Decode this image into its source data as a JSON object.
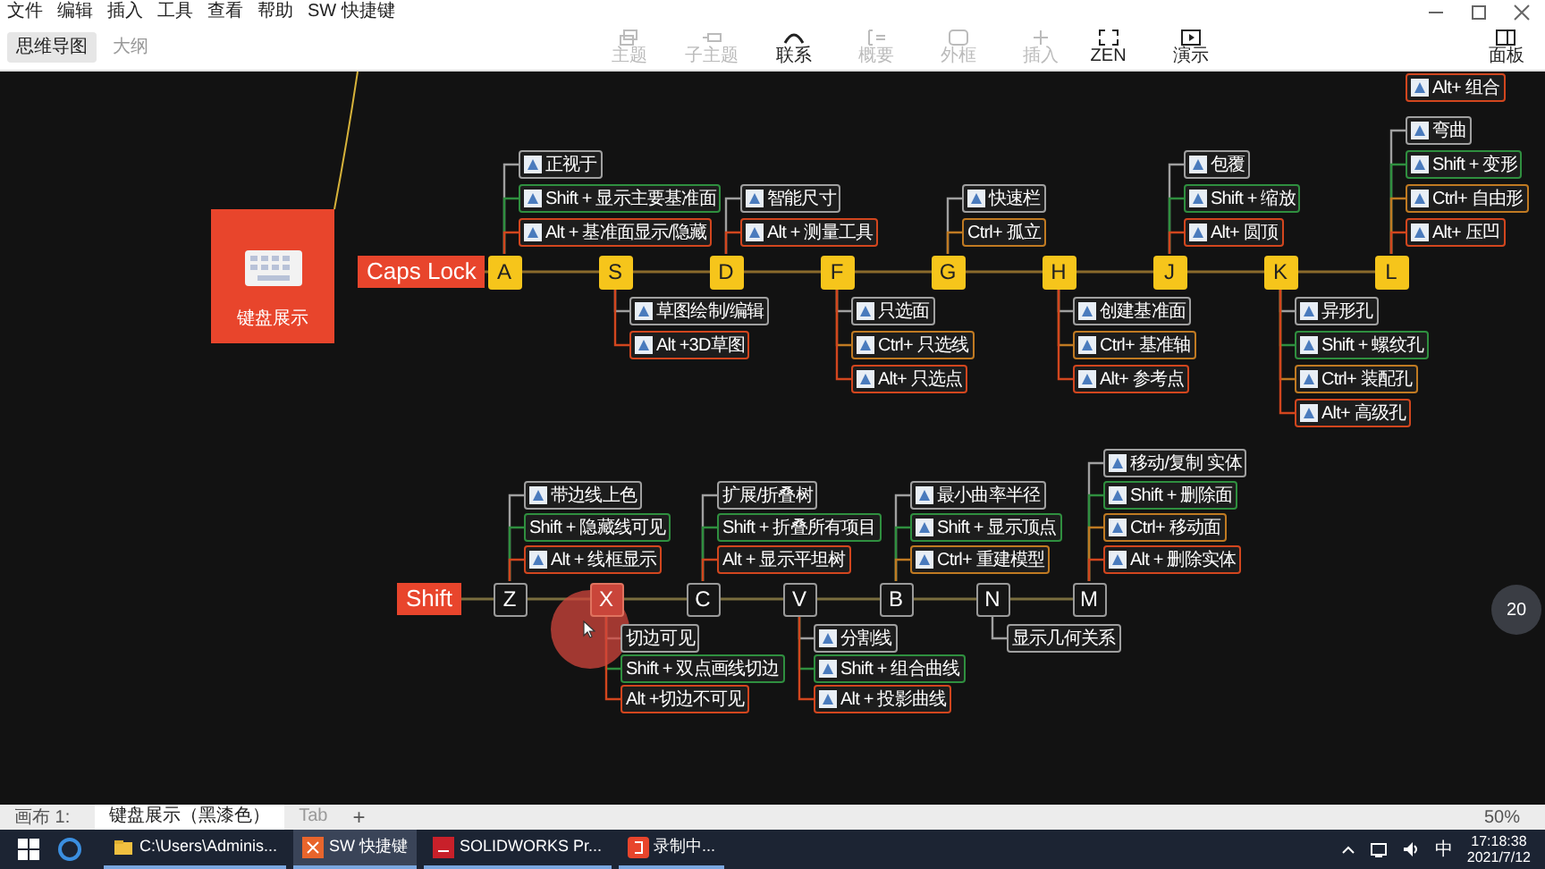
{
  "menu": [
    "文件",
    "编辑",
    "插入",
    "工具",
    "查看",
    "帮助",
    "SW 快捷键"
  ],
  "view_tabs": [
    {
      "label": "思维导图",
      "selected": true
    },
    {
      "label": "大纲",
      "selected": false
    }
  ],
  "toolbar": [
    {
      "label": "主题",
      "disabled": true
    },
    {
      "label": "子主题",
      "disabled": true
    },
    {
      "label": "联系",
      "disabled": false
    },
    {
      "label": "概要",
      "disabled": true
    },
    {
      "label": "外框",
      "disabled": true
    },
    {
      "label": "插入",
      "disabled": true
    }
  ],
  "right_tools": [
    {
      "label": "ZEN"
    },
    {
      "label": "演示"
    }
  ],
  "panel_button": "面板",
  "central_topic": "键盘展示",
  "top_partial_nodes": [
    {
      "text": "Alt+ 组合",
      "color": "#d2461e",
      "has_icon": true
    }
  ],
  "rows": [
    {
      "label": "Caps Lock",
      "keys": [
        {
          "key": "A",
          "kind": "yellow",
          "clicked": false,
          "above": [
            {
              "text": "正视于",
              "color": "#a0a0a0",
              "has_icon": true
            },
            {
              "text": "Shift + 显示主要基准面",
              "color": "#2f8f3f",
              "has_icon": true
            },
            {
              "text": "Alt + 基准面显示/隐藏",
              "color": "#d2461e",
              "has_icon": true
            }
          ]
        },
        {
          "key": "S",
          "kind": "yellow",
          "clicked": false,
          "below": [
            {
              "text": "草图绘制/编辑",
              "color": "#a0a0a0",
              "has_icon": true
            },
            {
              "text": "Alt +3D草图",
              "color": "#d2461e",
              "has_icon": true
            }
          ]
        },
        {
          "key": "D",
          "kind": "yellow",
          "clicked": false,
          "above": [
            {
              "text": "智能尺寸",
              "color": "#a0a0a0",
              "has_icon": true
            },
            {
              "text": "Alt + 测量工具",
              "color": "#d2461e",
              "has_icon": true
            }
          ]
        },
        {
          "key": "F",
          "kind": "yellow",
          "clicked": false,
          "below": [
            {
              "text": "只选面",
              "color": "#a0a0a0",
              "has_icon": true
            },
            {
              "text": "Ctrl+ 只选线",
              "color": "#c07a22",
              "has_icon": true
            },
            {
              "text": "Alt+ 只选点",
              "color": "#d2461e",
              "has_icon": true
            }
          ]
        },
        {
          "key": "G",
          "kind": "yellow",
          "clicked": false,
          "above": [
            {
              "text": "快速栏",
              "color": "#a0a0a0",
              "has_icon": true
            },
            {
              "text": "Ctrl+ 孤立",
              "color": "#c07a22",
              "has_icon": false
            }
          ]
        },
        {
          "key": "H",
          "kind": "yellow",
          "clicked": false,
          "below": [
            {
              "text": "创建基准面",
              "color": "#a0a0a0",
              "has_icon": true
            },
            {
              "text": "Ctrl+ 基准轴",
              "color": "#c07a22",
              "has_icon": true
            },
            {
              "text": "Alt+ 参考点",
              "color": "#d2461e",
              "has_icon": true
            }
          ]
        },
        {
          "key": "J",
          "kind": "yellow",
          "clicked": false,
          "above": [
            {
              "text": "包覆",
              "color": "#a0a0a0",
              "has_icon": true
            },
            {
              "text": "Shift + 缩放",
              "color": "#2f8f3f",
              "has_icon": true
            },
            {
              "text": "Alt+ 圆顶",
              "color": "#d2461e",
              "has_icon": true
            }
          ]
        },
        {
          "key": "K",
          "kind": "yellow",
          "clicked": false,
          "below": [
            {
              "text": "异形孔",
              "color": "#a0a0a0",
              "has_icon": true
            },
            {
              "text": "Shift + 螺纹孔",
              "color": "#2f8f3f",
              "has_icon": true
            },
            {
              "text": "Ctrl+ 装配孔",
              "color": "#c07a22",
              "has_icon": true
            },
            {
              "text": "Alt+ 高级孔",
              "color": "#d2461e",
              "has_icon": true
            }
          ]
        },
        {
          "key": "L",
          "kind": "yellow",
          "clicked": false,
          "above": [
            {
              "text": "弯曲",
              "color": "#a0a0a0",
              "has_icon": true
            },
            {
              "text": "Shift + 变形",
              "color": "#2f8f3f",
              "has_icon": true
            },
            {
              "text": "Ctrl+ 自由形",
              "color": "#c07a22",
              "has_icon": true
            },
            {
              "text": "Alt+ 压凹",
              "color": "#d2461e",
              "has_icon": true
            }
          ]
        }
      ]
    },
    {
      "label": "Shift",
      "keys": [
        {
          "key": "Z",
          "kind": "dark",
          "clicked": false,
          "above": [
            {
              "text": "带边线上色",
              "color": "#a0a0a0",
              "has_icon": true
            },
            {
              "text": "Shift + 隐藏线可见",
              "color": "#2f8f3f",
              "has_icon": false
            },
            {
              "text": "Alt + 线框显示",
              "color": "#d2461e",
              "has_icon": true
            }
          ]
        },
        {
          "key": "X",
          "kind": "dark",
          "clicked": true,
          "below": [
            {
              "text": "切边可见",
              "color": "#a0a0a0",
              "has_icon": false
            },
            {
              "text": "Shift + 双点画线切边",
              "color": "#2f8f3f",
              "has_icon": false
            },
            {
              "text": "Alt +切边不可见",
              "color": "#d2461e",
              "has_icon": false
            }
          ]
        },
        {
          "key": "C",
          "kind": "dark",
          "clicked": false,
          "above": [
            {
              "text": "扩展/折叠树",
              "color": "#a0a0a0",
              "has_icon": false
            },
            {
              "text": "Shift + 折叠所有项目",
              "color": "#2f8f3f",
              "has_icon": false
            },
            {
              "text": "Alt + 显示平坦树",
              "color": "#d2461e",
              "has_icon": false
            }
          ]
        },
        {
          "key": "V",
          "kind": "dark",
          "clicked": false,
          "below": [
            {
              "text": "分割线",
              "color": "#a0a0a0",
              "has_icon": true
            },
            {
              "text": "Shift + 组合曲线",
              "color": "#2f8f3f",
              "has_icon": true
            },
            {
              "text": "Alt + 投影曲线",
              "color": "#d2461e",
              "has_icon": true
            }
          ]
        },
        {
          "key": "B",
          "kind": "dark",
          "clicked": false,
          "above": [
            {
              "text": "最小曲率半径",
              "color": "#a0a0a0",
              "has_icon": true
            },
            {
              "text": "Shift + 显示顶点",
              "color": "#2f8f3f",
              "has_icon": true
            },
            {
              "text": "Ctrl+ 重建模型",
              "color": "#c07a22",
              "has_icon": true
            }
          ]
        },
        {
          "key": "N",
          "kind": "dark",
          "clicked": false,
          "below": [
            {
              "text": "显示几何关系",
              "color": "#a0a0a0",
              "has_icon": false
            }
          ]
        },
        {
          "key": "M",
          "kind": "dark",
          "clicked": false,
          "above": [
            {
              "text": "移动/复制 实体",
              "color": "#a0a0a0",
              "has_icon": true
            },
            {
              "text": "Shift + 删除面",
              "color": "#2f8f3f",
              "has_icon": true
            },
            {
              "text": "Ctrl+ 移动面",
              "color": "#c07a22",
              "has_icon": true
            },
            {
              "text": "Alt + 删除实体",
              "color": "#d2461e",
              "has_icon": true
            }
          ]
        }
      ]
    }
  ],
  "timer": "20",
  "sheet_bar": {
    "canvas_label": "画布 1:",
    "tabs": [
      {
        "label": "键盘展示（黑漆色）",
        "selected": true
      },
      {
        "label": "Tab",
        "selected": false
      }
    ],
    "add": "+",
    "zoom": "50%"
  },
  "taskbar": {
    "apps": [
      {
        "label": "C:\\Users\\Adminis...",
        "active": false
      },
      {
        "label": "SW 快捷键",
        "active": true
      },
      {
        "label": "SOLIDWORKS Pr...",
        "active": false
      },
      {
        "label": "录制中...",
        "active": false
      }
    ],
    "ime": "中",
    "time": "17:18:38",
    "date": "2021/7/12"
  }
}
